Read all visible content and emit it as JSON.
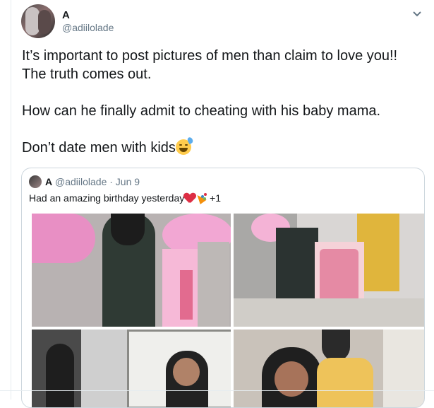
{
  "tweet": {
    "display_name": "A",
    "handle": "@adiilolade",
    "lines": [
      "It’s important to post pictures of men than claim to love you!!",
      "The truth comes out.",
      "How can he finally admit to cheating with his baby mama.",
      "Don’t date men with kids"
    ],
    "emoji": "grinning-face-with-sweat"
  },
  "quoted": {
    "display_name": "A",
    "meta": "@adiilolade · Jun 9",
    "text": "Had an amazing birthday yesterday",
    "extra_count": "+1",
    "photos": [
      "balloon-dress-photo",
      "birthday-cake-couple-photo",
      "mirror-selfie-photo",
      "couple-smiling-photo"
    ]
  },
  "colors": {
    "text": "#14171a",
    "secondary": "#657786",
    "border": "#ccd6dd",
    "heart": "#dd2e44"
  }
}
